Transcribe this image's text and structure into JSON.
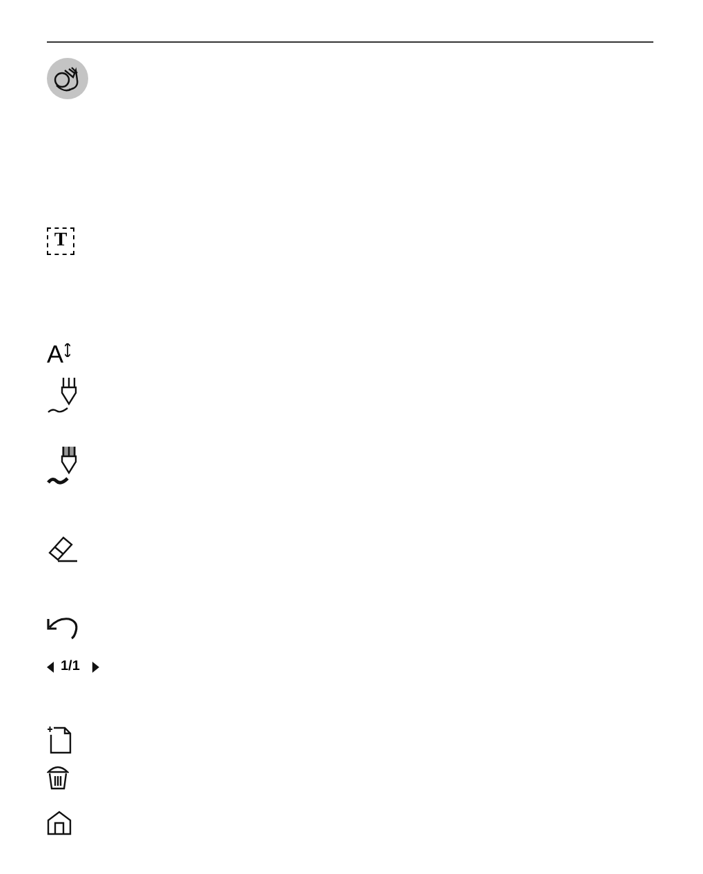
{
  "items": [
    {
      "kind": "gesture"
    },
    {
      "kind": "text_tool",
      "label": "T"
    },
    {
      "kind": "font_size",
      "label": "A"
    },
    {
      "kind": "thin_pen"
    },
    {
      "kind": "thick_pen"
    },
    {
      "kind": "eraser"
    },
    {
      "kind": "undo"
    },
    {
      "kind": "pager",
      "label": "1/1"
    },
    {
      "kind": "new_page"
    },
    {
      "kind": "trash"
    },
    {
      "kind": "home"
    }
  ]
}
